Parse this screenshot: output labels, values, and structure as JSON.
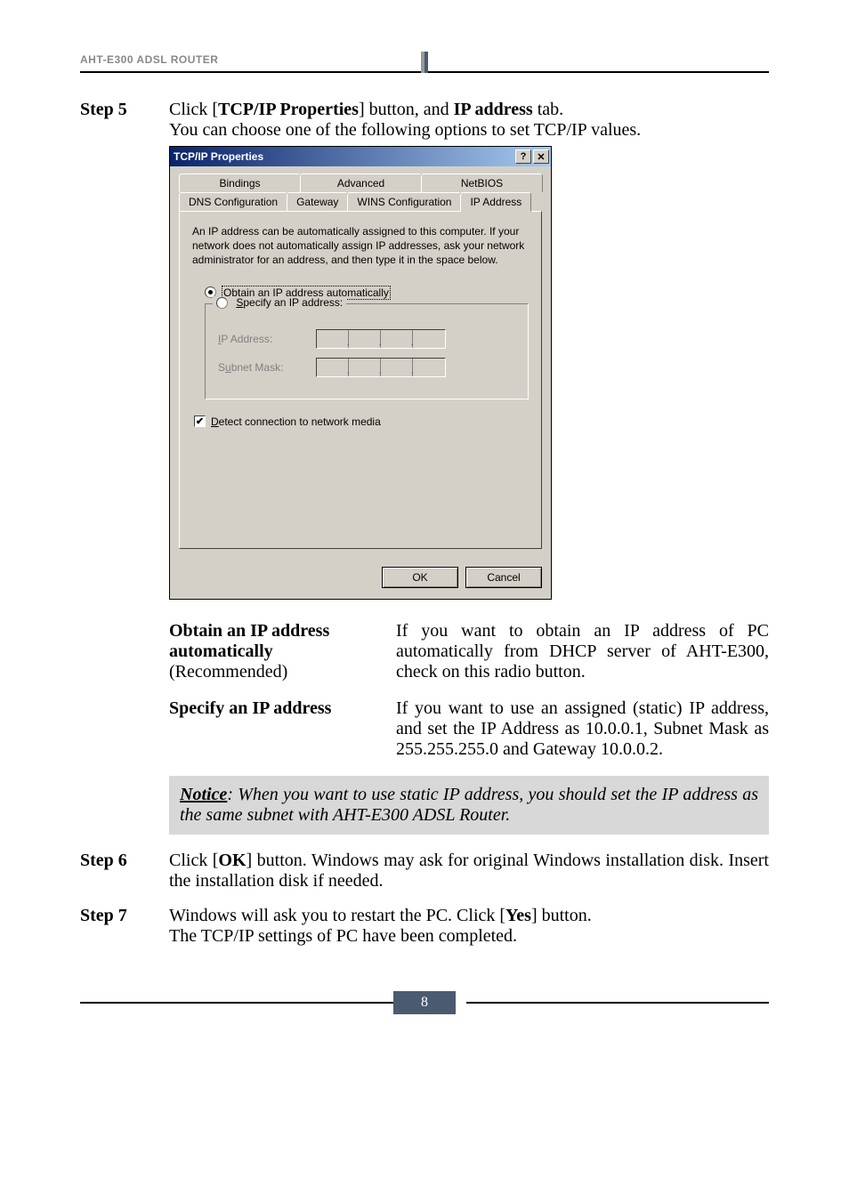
{
  "header": {
    "title": "AHT-E300 ADSL ROUTER"
  },
  "step5": {
    "label": "Step 5",
    "line1_pre": "Click [",
    "line1_bold": "TCP/IP Properties",
    "line1_mid": "] button, and ",
    "line1_bold2": "IP address",
    "line1_post": " tab.",
    "line2": "You can choose one of the following options to set TCP/IP values."
  },
  "dialog": {
    "title": "TCP/IP Properties",
    "help_icon": "?",
    "close_icon": "✕",
    "tabs_back": {
      "bindings": "Bindings",
      "advanced": "Advanced",
      "netbios": "NetBIOS"
    },
    "tabs_front": {
      "dns": "DNS Configuration",
      "gateway": "Gateway",
      "wins": "WINS Configuration",
      "ip": "IP Address"
    },
    "desc": "An IP address can be automatically assigned to this computer. If your network does not automatically assign IP addresses, ask your network administrator for an address, and then type it in the space below.",
    "radio_auto_pre": "O",
    "radio_auto_rest": "btain an IP address automatically",
    "radio_specify_pre": "S",
    "radio_specify_rest": "pecify an IP address:",
    "ip_label_pre": "I",
    "ip_label_rest": "P Address:",
    "subnet_label": "Subnet Mask:",
    "subnet_underline": "u",
    "detect_pre": "D",
    "detect_rest": "etect connection to network media",
    "ok": "OK",
    "cancel": "Cancel"
  },
  "option1": {
    "title_l1": "Obtain an IP address",
    "title_l2": "automatically",
    "title_l3": "(Recommended)",
    "desc": "If you want to obtain an IP address of PC automatically from DHCP server of AHT-E300, check on this radio button."
  },
  "option2": {
    "title": "Specify an IP address",
    "desc": "If you want to use an assigned (static) IP address, and set the IP Address as 10.0.0.1, Subnet Mask as 255.255.255.0 and Gateway 10.0.0.2."
  },
  "notice": {
    "label": "Notice",
    "text": ": When you want to use static IP address, you should set the IP address as the same subnet with AHT-E300 ADSL Router."
  },
  "step6": {
    "label": "Step 6",
    "pre": "Click [",
    "bold": "OK",
    "post": "] button. Windows may ask for original Windows installation disk. Insert the installation disk if needed."
  },
  "step7": {
    "label": "Step 7",
    "pre": "Windows will ask you to restart the PC. Click [",
    "bold": "Yes",
    "post": "] button.",
    "line2": "The TCP/IP settings of PC have been completed."
  },
  "page_number": "8"
}
